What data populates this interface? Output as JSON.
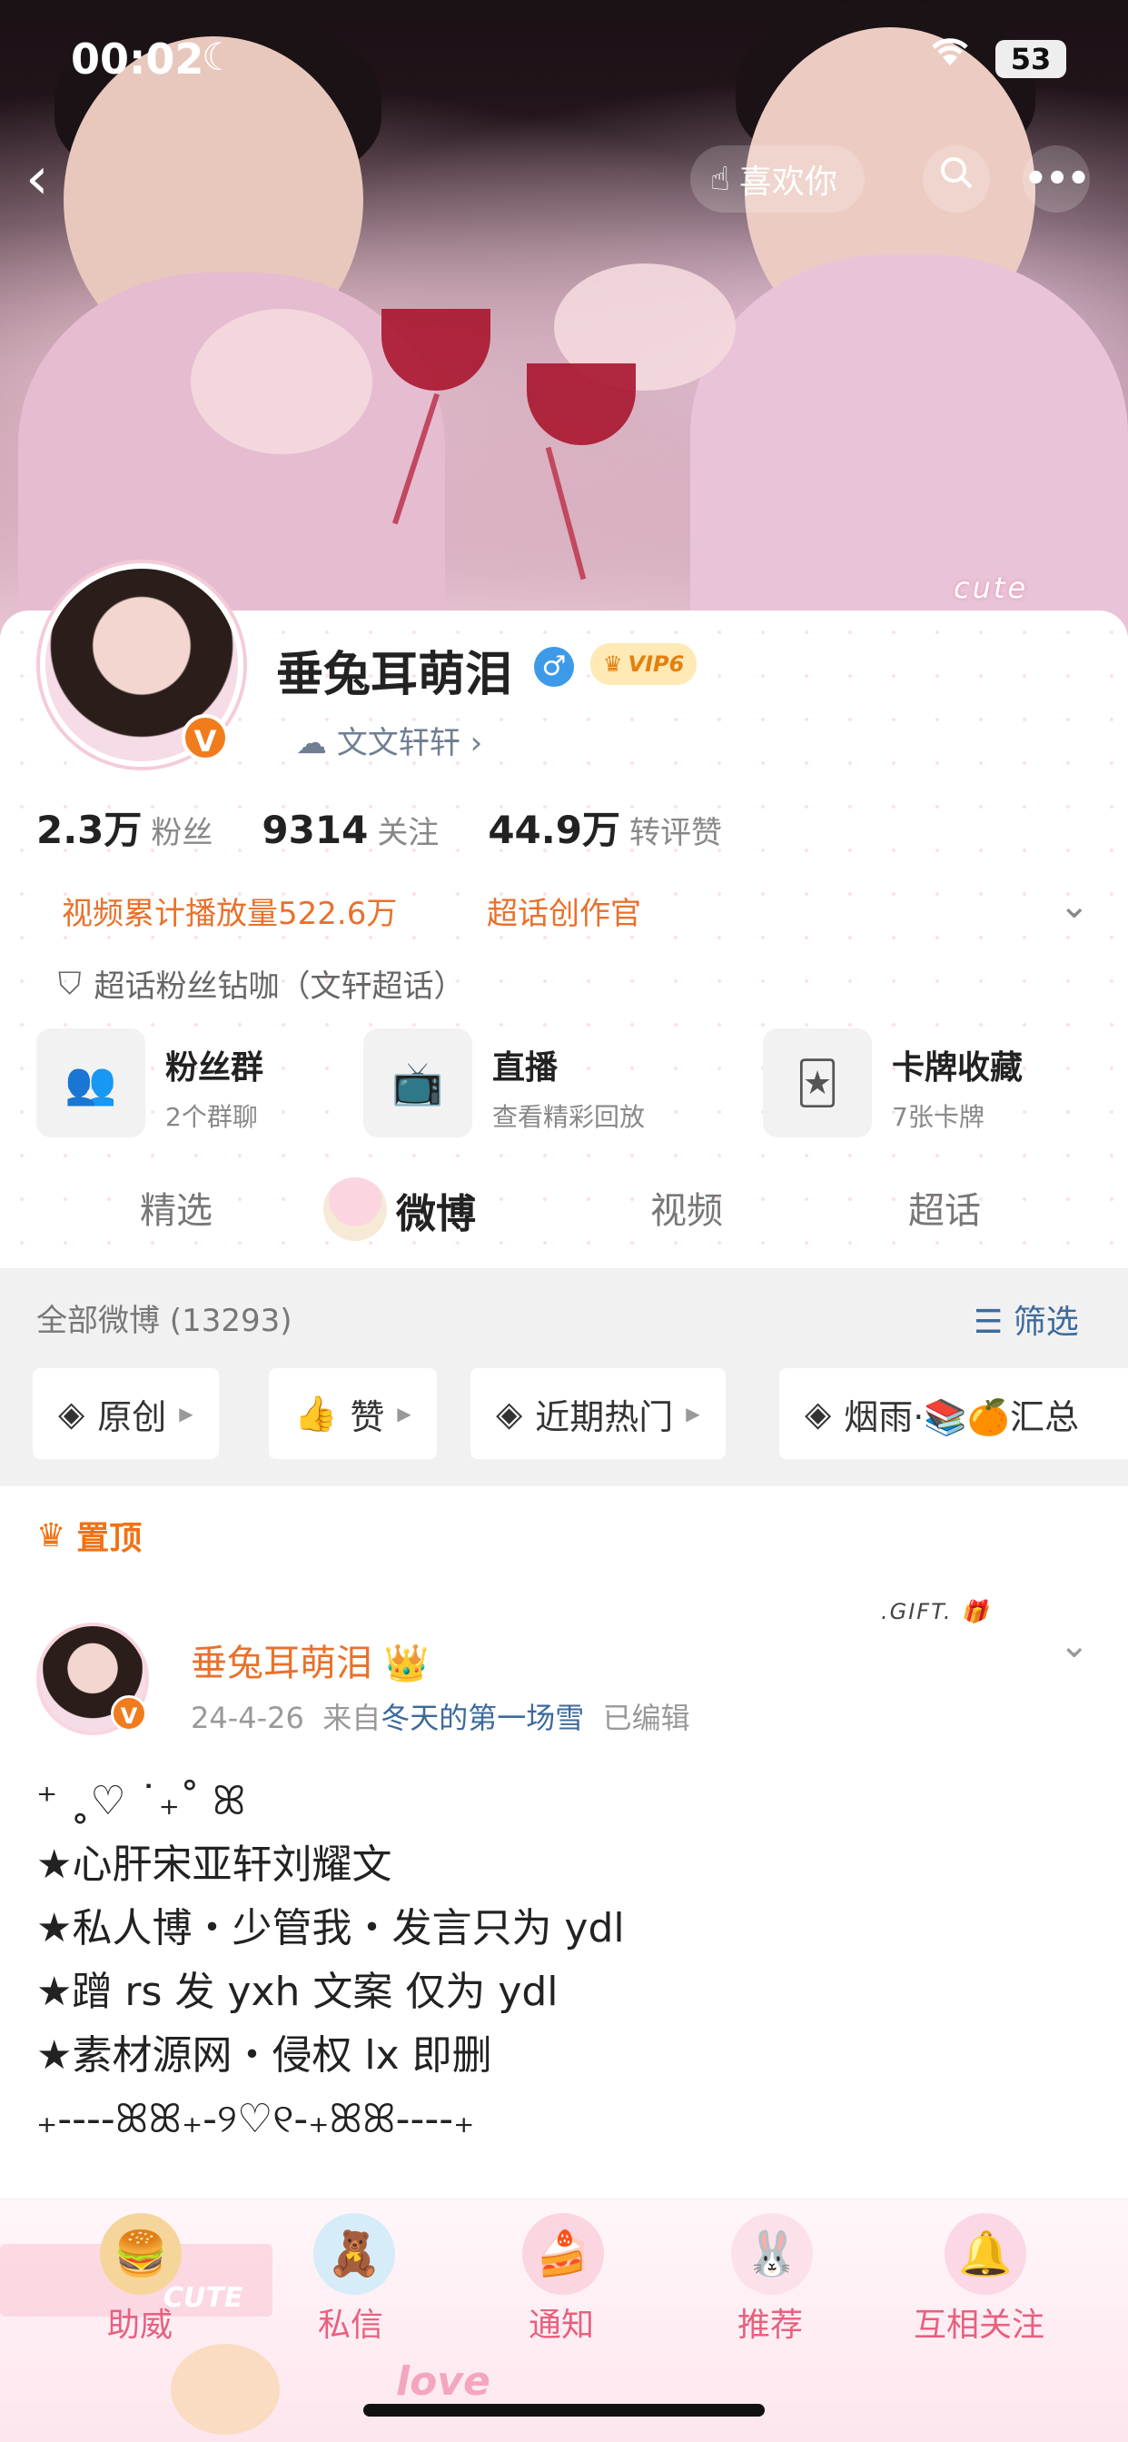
{
  "status": {
    "time": "00:02",
    "battery": "53"
  },
  "header": {
    "like_label": "喜欢你",
    "cute_badge": "cute"
  },
  "profile": {
    "name": "垂兔耳萌泪",
    "gender_symbol": "♂",
    "vip_label": "VIP6",
    "sub_name": "文文轩轩 ›",
    "stats": [
      {
        "num": "2.3万",
        "label": "粉丝"
      },
      {
        "num": "9314",
        "label": "关注"
      },
      {
        "num": "44.9万",
        "label": "转评赞"
      }
    ],
    "video_plays": "视频累计播放量522.6万",
    "super_topic_creator": "超话创作官",
    "super_fan": "超话粉丝钻咖（文轩超话）",
    "tiles": [
      {
        "title": "粉丝群",
        "sub": "2个群聊"
      },
      {
        "title": "直播",
        "sub": "查看精彩回放"
      },
      {
        "title": "卡牌收藏",
        "sub": "7张卡牌"
      }
    ]
  },
  "tabs": [
    "精选",
    "微博",
    "视频",
    "超话"
  ],
  "feed": {
    "all_count": "全部微博 (13293)",
    "filter": "筛选",
    "chips": [
      "原创",
      "赞",
      "近期热门",
      "烟雨·📚🍊汇总"
    ],
    "pinned": "置顶"
  },
  "post": {
    "name": "垂兔耳萌泪",
    "date": "24-4-26",
    "from_prefix": "来自",
    "source": "冬天的第一场雪",
    "edited": "已编辑",
    "gift": ".GIFT.",
    "lines": [
      "⁺ ˳♡ ˙₊˚ ꕤ",
      "★心肝宋亚轩刘耀文",
      "★私人博・少管我・发言只为 ydl",
      "★蹭 rs 发 yxh 文案 仅为 ydl",
      "★素材源网・侵权 lx 即删",
      "₊----ꕤꕤ₊-୨♡୧-₊ꕤꕤ----₊"
    ]
  },
  "bottom_nav": [
    "助威",
    "私信",
    "通知",
    "推荐",
    "互相关注"
  ],
  "bottom_decor": {
    "love": "love",
    "cute": "CUTE"
  }
}
